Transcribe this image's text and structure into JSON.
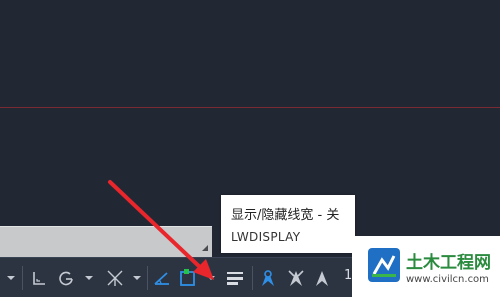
{
  "tooltip": {
    "title": "显示/隐藏线宽 - 关",
    "command": "LWDISPLAY"
  },
  "status_bar": {
    "scale_text": "1:"
  },
  "watermark": {
    "title": "土木工程网",
    "url": "www.civilcn.com"
  },
  "colors": {
    "canvas": "#212834",
    "status_bar": "#2c3442",
    "crosshair": "#7a2a33",
    "arrow": "#e8262b",
    "accent_blue": "#2f8fe6",
    "icon_gray": "#c5cad2",
    "watermark_green": "#2a8a3e"
  },
  "icons": [
    "chevron-down-icon",
    "ortho-icon",
    "polar-tracking-icon",
    "isodraft-icon",
    "object-snap-tracking-icon",
    "object-snap-icon",
    "lineweight-icon",
    "annotation-visibility-icon",
    "auto-scale-icon",
    "annotation-scale-icon"
  ]
}
